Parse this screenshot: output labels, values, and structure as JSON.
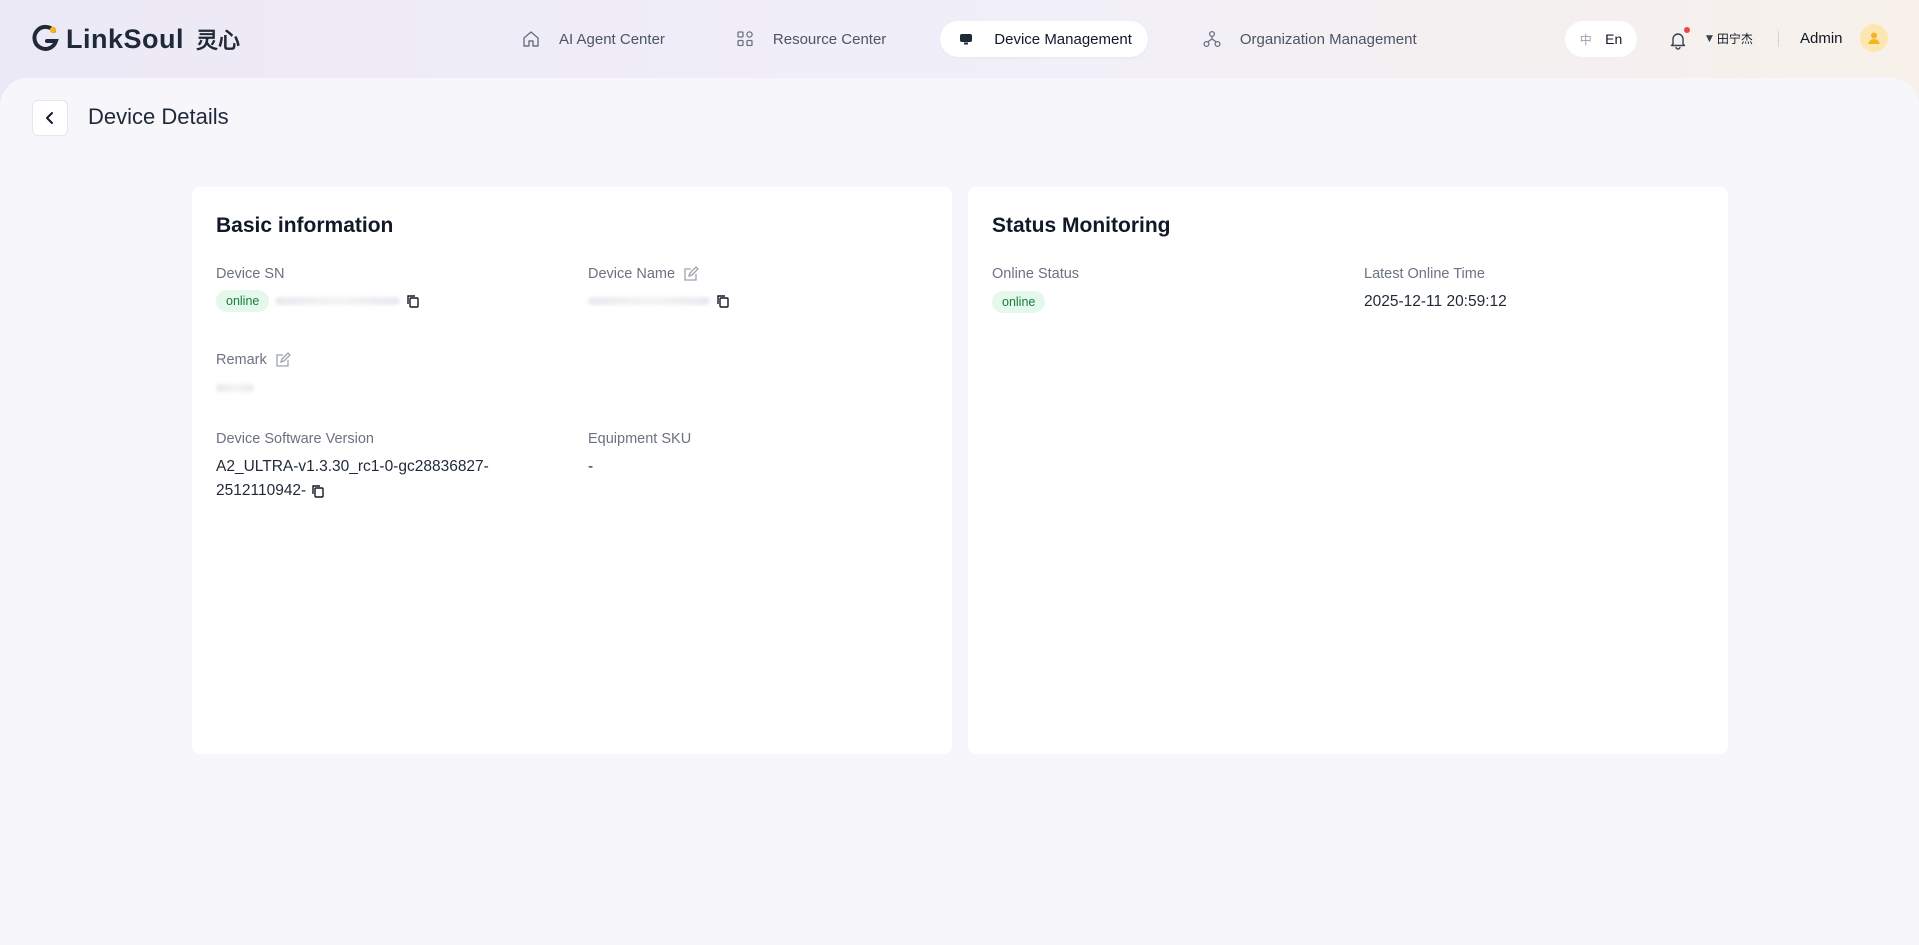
{
  "app": {
    "brand": "LinkSoul",
    "brand_cn": "灵心"
  },
  "nav": {
    "items": [
      {
        "label": "AI Agent Center",
        "icon": "home-icon"
      },
      {
        "label": "Resource Center",
        "icon": "apps-grid-icon"
      },
      {
        "label": "Device Management",
        "icon": "device-icon",
        "active": true
      },
      {
        "label": "Organization Management",
        "icon": "org-tree-icon"
      }
    ]
  },
  "header": {
    "lang_zh": "中",
    "lang_en": "En",
    "org_name": "田宁杰",
    "user_name": "Admin"
  },
  "page": {
    "title": "Device Details"
  },
  "basic_info": {
    "title": "Basic information",
    "device_sn_label": "Device SN",
    "device_sn_status": "online",
    "device_name_label": "Device Name",
    "remark_label": "Remark",
    "software_version_label": "Device Software Version",
    "software_version_value": "A2_ULTRA-v1.3.30_rc1-0-gc28836827-2512110942-",
    "sku_label": "Equipment SKU",
    "sku_value": "-"
  },
  "status_monitoring": {
    "title": "Status Monitoring",
    "online_status_label": "Online Status",
    "online_status_value": "online",
    "latest_online_label": "Latest Online Time",
    "latest_online_value": "2025-12-11 20:59:12"
  },
  "colors": {
    "accent_orange": "#f5b324",
    "online_bg": "#e5f8ec",
    "online_text": "#15803d",
    "notification_dot": "#ef4444"
  }
}
